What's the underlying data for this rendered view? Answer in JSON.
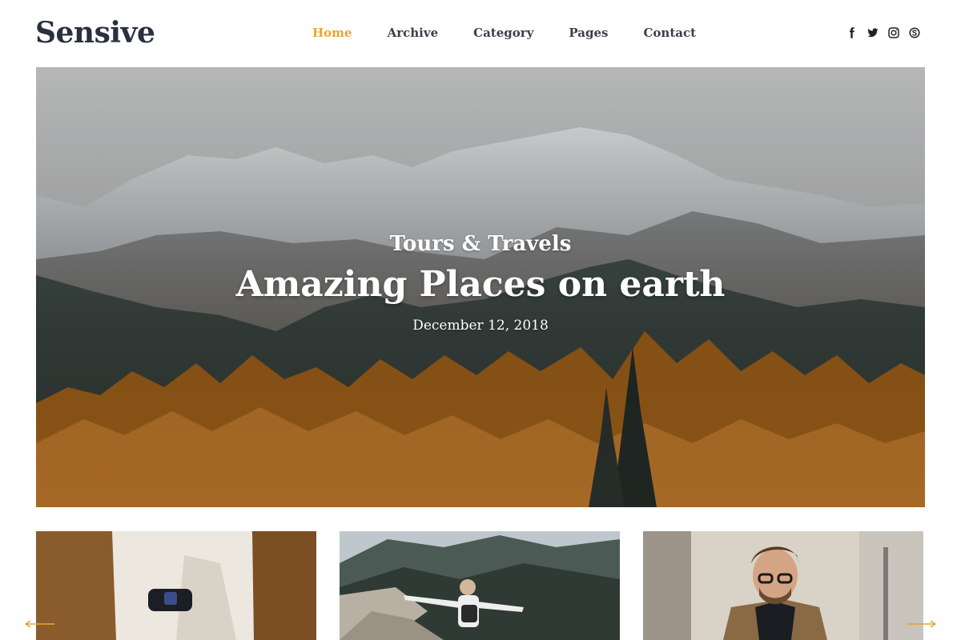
{
  "brand": {
    "logo": "Sensive"
  },
  "nav": {
    "items": [
      {
        "label": "Home",
        "active": true
      },
      {
        "label": "Archive",
        "active": false
      },
      {
        "label": "Category",
        "active": false
      },
      {
        "label": "Pages",
        "active": false
      },
      {
        "label": "Contact",
        "active": false
      }
    ]
  },
  "social": [
    "facebook-icon",
    "twitter-icon",
    "instagram-icon",
    "skype-icon"
  ],
  "hero": {
    "category": "Tours & Travels",
    "title": "Amazing Places on earth",
    "date": "December 12, 2018"
  },
  "colors": {
    "accent": "#e7a535",
    "text_dark": "#2b3040"
  }
}
